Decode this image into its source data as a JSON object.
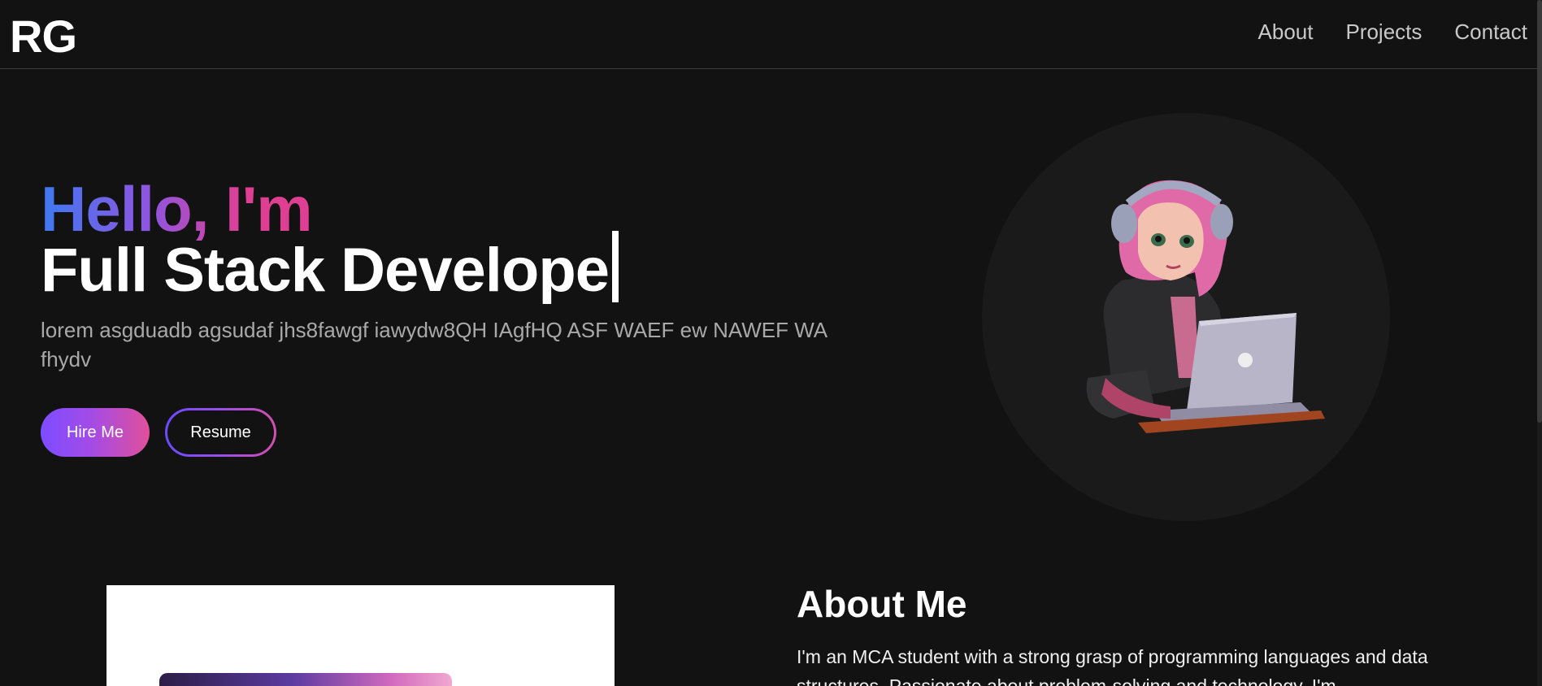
{
  "nav": {
    "logo": "RG",
    "links": [
      {
        "label": "About"
      },
      {
        "label": "Projects"
      },
      {
        "label": "Contact"
      }
    ]
  },
  "hero": {
    "greeting": "Hello, I'm",
    "role": "Full Stack Develope",
    "description": "lorem asgduadb agsudaf jhs8fawgf iawydw8QH IAgfHQ ASF WAEF ew NAWEF WA fhydv",
    "buttons": {
      "hire": "Hire Me",
      "resume": "Resume"
    },
    "avatar": {
      "name": "girl-with-laptop-avatar",
      "colors": {
        "hair": "#e06aa8",
        "hoodie": "#2c2c2e",
        "laptop": "#b8b5c8"
      }
    }
  },
  "about": {
    "title": "About Me",
    "text": "I'm an MCA student with a strong grasp of programming languages and data structures. Passionate about problem-solving and technology, I'm"
  },
  "colors": {
    "background": "#121212",
    "gradient_start": "#3e79f2",
    "gradient_mid": "#8f55e0",
    "gradient_end": "#df3f93",
    "nav_text": "#c9c9c9",
    "muted_text": "#a9a9a9"
  }
}
